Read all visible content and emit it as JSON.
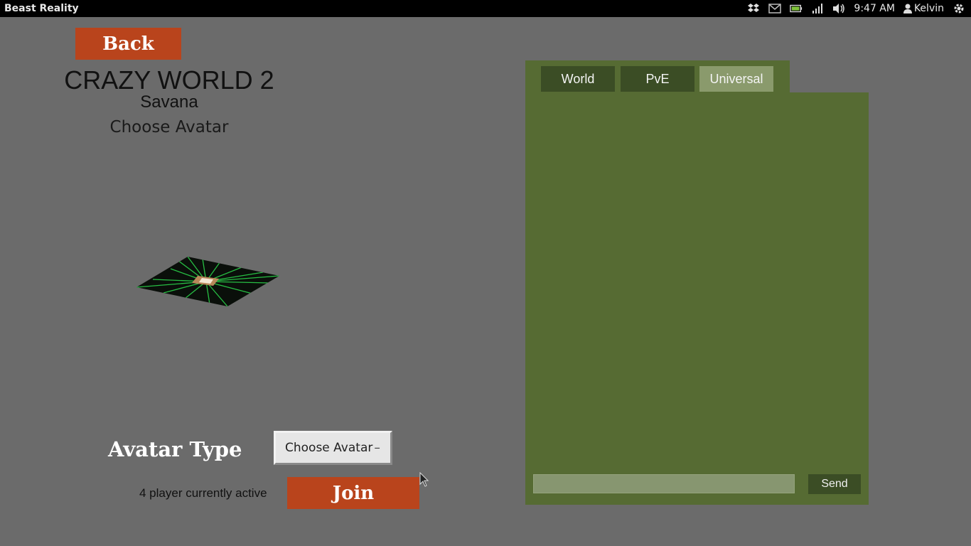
{
  "topbar": {
    "app_title": "Beast Reality",
    "clock": "9:47 AM",
    "user": "Kelvin",
    "icons": [
      "dropbox-icon",
      "mail-icon",
      "battery-icon",
      "signal-icon",
      "volume-icon",
      "user-icon",
      "gear-icon"
    ]
  },
  "main": {
    "back_label": "Back",
    "world_title": "CRAZY WORLD 2",
    "world_subtitle": "Savana",
    "choose_heading": "Choose Avatar",
    "avatar_type_label": "Avatar Type",
    "avatar_select_value": "Choose Avatar",
    "players_text": "4 player currently active",
    "join_label": "Join"
  },
  "chat": {
    "tabs": [
      {
        "label": "World",
        "active": false
      },
      {
        "label": "PvE",
        "active": false
      },
      {
        "label": "Universal",
        "active": true
      }
    ],
    "input_value": "",
    "send_label": "Send"
  },
  "colors": {
    "background": "#6b6b6b",
    "button_accent": "#b9441c",
    "chat_panel": "#566b33",
    "tab_inactive": "#3b4d25",
    "tab_active": "#8a9a6c"
  }
}
